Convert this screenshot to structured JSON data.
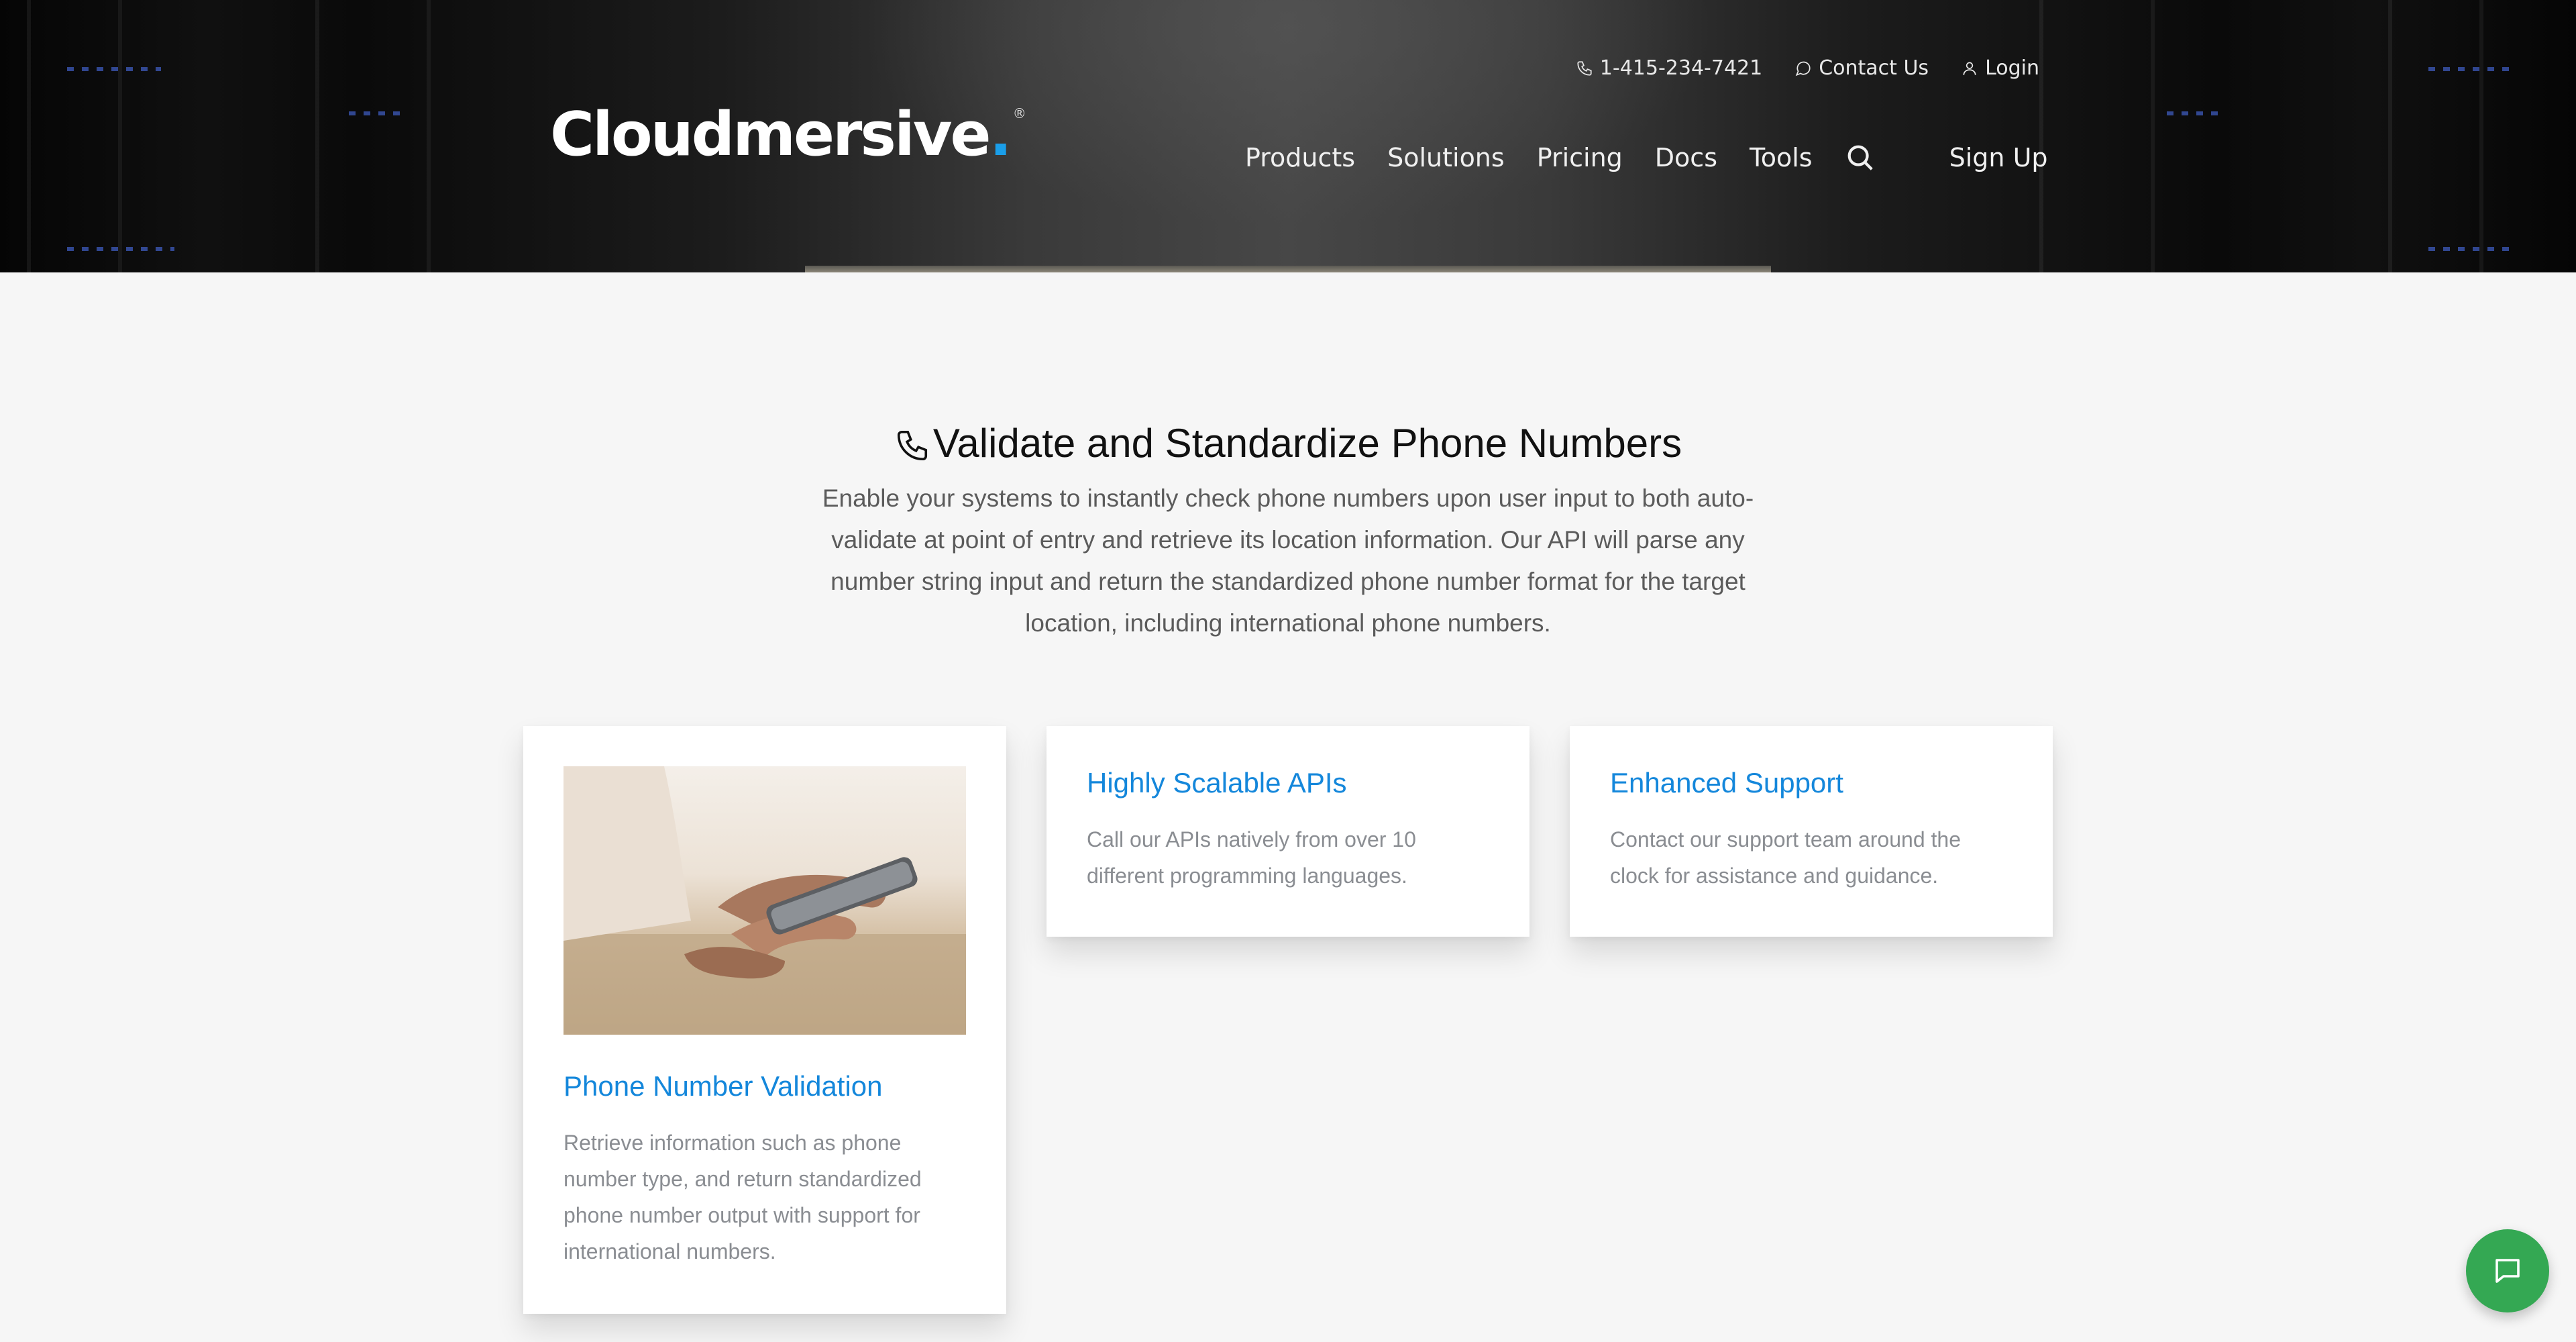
{
  "header": {
    "brand": "Cloudmersive",
    "brand_dot": ".",
    "brand_reg": "®",
    "topbar": {
      "phone": "1-415-234-7421",
      "contact": "Contact Us",
      "login": "Login"
    },
    "nav": [
      "Products",
      "Solutions",
      "Pricing",
      "Docs",
      "Tools"
    ],
    "signup": "Sign Up"
  },
  "intro": {
    "title": "Validate and Standardize Phone Numbers",
    "description": "Enable your systems to instantly check phone numbers upon user input to both auto-validate at point of entry and retrieve its location information. Our API will parse any number string input and return the standardized phone number format for the target location, including international phone numbers."
  },
  "cards": [
    {
      "title": "Phone Number Validation",
      "text": "Retrieve information such as phone number type, and return standardized phone number output with support for international numbers."
    },
    {
      "title": "Highly Scalable APIs",
      "text": "Call our APIs natively from over 10 different programming languages."
    },
    {
      "title": "Enhanced Support",
      "text": "Contact our support team around the clock for assistance and guidance."
    }
  ],
  "colors": {
    "accent": "#1487db",
    "brand_dot": "#1a9ee9",
    "chat": "#34a853"
  },
  "icons": {
    "phone": "phone-icon",
    "contact": "chat-bubble-icon",
    "login": "user-icon",
    "search": "search-icon",
    "chat_widget": "chat-icon"
  }
}
